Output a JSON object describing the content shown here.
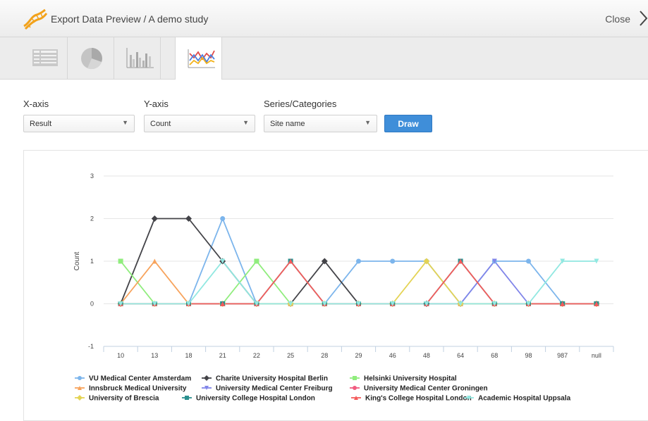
{
  "window": {
    "title": "Export Data Preview / A demo study",
    "close_label": "Close"
  },
  "tabs": [
    {
      "name": "table-view",
      "icon": "table-icon"
    },
    {
      "name": "pie-chart-view",
      "icon": "pie-chart-icon"
    },
    {
      "name": "bar-chart-view",
      "icon": "bar-chart-icon"
    },
    {
      "name": "line-chart-view",
      "icon": "line-chart-icon",
      "active": true
    }
  ],
  "form": {
    "x_axis_label": "X-axis",
    "x_axis_value": "Result",
    "y_axis_label": "Y-axis",
    "y_axis_value": "Count",
    "series_label": "Series/Categories",
    "series_value": "Site name",
    "draw_label": "Draw"
  },
  "chart_data": {
    "type": "line",
    "ylabel": "Count",
    "xlabel": "",
    "ylim": [
      -1,
      3
    ],
    "yticks": [
      -1,
      0,
      1,
      2,
      3
    ],
    "categories": [
      "10",
      "13",
      "18",
      "21",
      "22",
      "25",
      "28",
      "29",
      "46",
      "48",
      "64",
      "68",
      "98",
      "987",
      "null"
    ],
    "grid": true,
    "legend_position": "bottom",
    "series": [
      {
        "name": "VU Medical Center Amsterdam",
        "color": "#7cb5ec",
        "marker": "circle",
        "values": [
          0,
          0,
          0,
          2,
          0,
          0,
          0,
          1,
          1,
          1,
          0,
          1,
          1,
          0,
          0
        ]
      },
      {
        "name": "Charite University Hospital Berlin",
        "color": "#434348",
        "marker": "diamond",
        "values": [
          0,
          2,
          2,
          1,
          0,
          0,
          1,
          0,
          0,
          0,
          0,
          0,
          0,
          0,
          0
        ]
      },
      {
        "name": "Helsinki University Hospital",
        "color": "#90ed7d",
        "marker": "square",
        "values": [
          1,
          0,
          0,
          0,
          1,
          0,
          0,
          0,
          0,
          0,
          0,
          0,
          0,
          0,
          0
        ]
      },
      {
        "name": "Innsbruck Medical University",
        "color": "#f7a35c",
        "marker": "triangle",
        "values": [
          0,
          1,
          0,
          0,
          0,
          0,
          0,
          0,
          0,
          0,
          0,
          0,
          0,
          0,
          0
        ]
      },
      {
        "name": "University Medical Center Freiburg",
        "color": "#8085e9",
        "marker": "triangle-down",
        "values": [
          0,
          0,
          0,
          0,
          0,
          0,
          0,
          0,
          0,
          0,
          0,
          1,
          0,
          0,
          0
        ]
      },
      {
        "name": "University Medical Center Groningen",
        "color": "#f15c80",
        "marker": "circle",
        "values": [
          0,
          0,
          0,
          0,
          0,
          0,
          0,
          0,
          0,
          0,
          0,
          0,
          0,
          0,
          0
        ]
      },
      {
        "name": "University of Brescia",
        "color": "#e4d354",
        "marker": "diamond",
        "values": [
          0,
          0,
          0,
          0,
          0,
          0,
          0,
          0,
          0,
          1,
          0,
          0,
          0,
          0,
          0
        ]
      },
      {
        "name": "University College Hospital London",
        "color": "#2b908f",
        "marker": "square",
        "values": [
          0,
          0,
          0,
          0,
          0,
          1,
          0,
          0,
          0,
          0,
          1,
          0,
          0,
          0,
          0
        ]
      },
      {
        "name": "King's College Hospital London",
        "color": "#f45b5b",
        "marker": "triangle",
        "values": [
          0,
          0,
          0,
          0,
          0,
          1,
          0,
          0,
          0,
          0,
          1,
          0,
          0,
          0,
          0
        ]
      },
      {
        "name": "Academic Hospital Uppsala",
        "color": "#91e8e1",
        "marker": "triangle-down",
        "values": [
          0,
          0,
          0,
          1,
          0,
          0,
          0,
          0,
          0,
          0,
          0,
          0,
          0,
          1,
          1
        ]
      }
    ]
  }
}
